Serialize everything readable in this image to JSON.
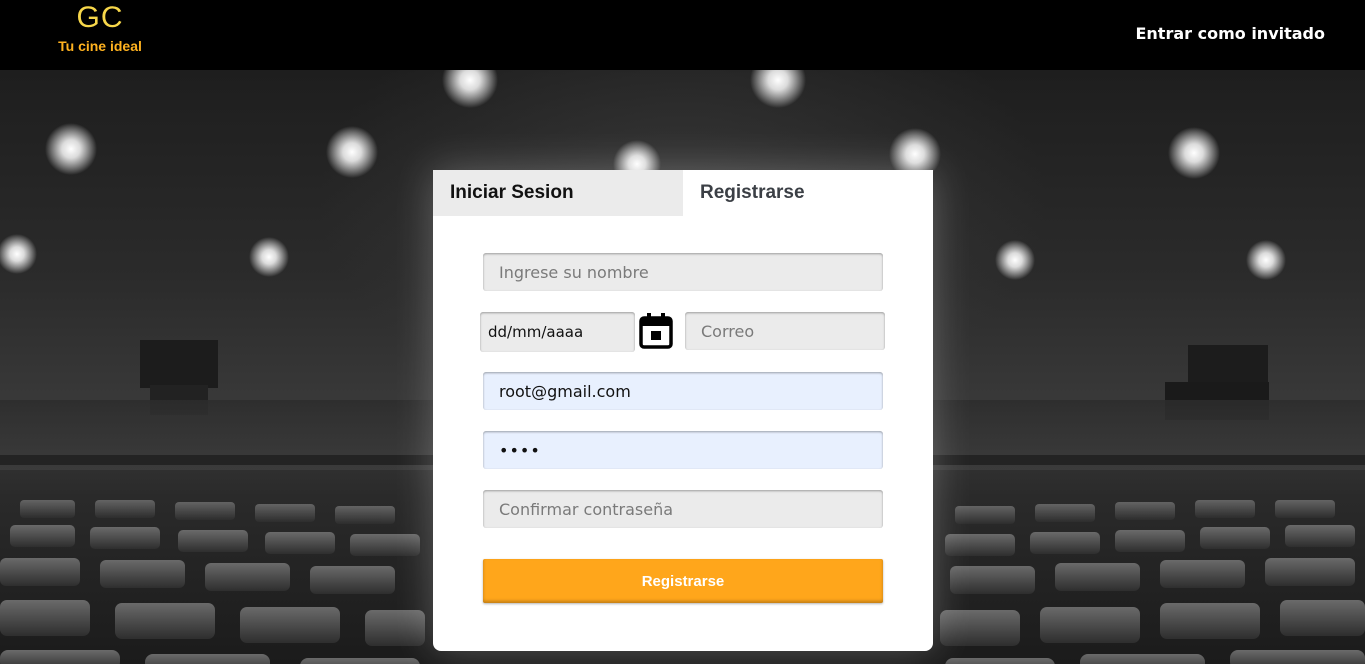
{
  "header": {
    "logo_mark": "GC",
    "logo_tagline": "Tu cine ideal",
    "guest_link": "Entrar como invitado"
  },
  "auth": {
    "tabs": [
      {
        "label": "Iniciar Sesion",
        "active": false
      },
      {
        "label": "Registrarse",
        "active": true
      }
    ],
    "fields": {
      "name": {
        "placeholder": "Ingrese su nombre",
        "value": ""
      },
      "birthdate": {
        "display": "dd/mm/aaaa",
        "value": ""
      },
      "email": {
        "placeholder": "Correo",
        "value": ""
      },
      "username": {
        "placeholder": "",
        "value": "root@gmail.com"
      },
      "password": {
        "placeholder": "",
        "value": "••••"
      },
      "confirm_password": {
        "placeholder": "Confirmar contraseña",
        "value": ""
      }
    },
    "submit_label": "Registrarse"
  },
  "colors": {
    "header_bg": "#000000",
    "logo_mark": "#f7d74a",
    "logo_tagline": "#ffb21f",
    "submit_bg": "#ffa61b",
    "field_bg": "#ebebeb",
    "autofill_bg": "#e8f0fe"
  }
}
